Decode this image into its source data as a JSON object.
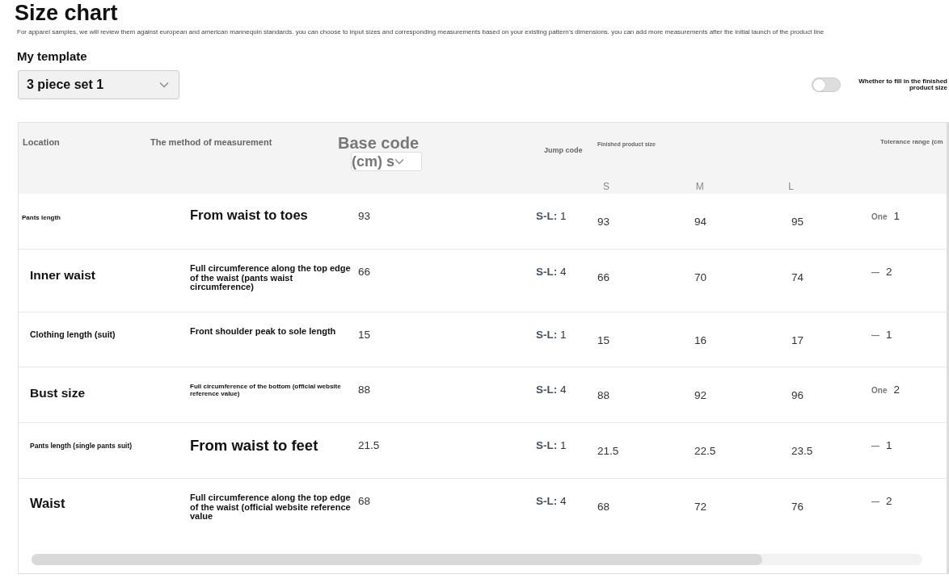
{
  "title": "Size chart",
  "description": "For apparel samples, we will review them against european and american mannequin standards. you can choose to input sizes and corresponding measurements based on your existing pattern's dimensions. you can add more measurements after the initial launch of the product line",
  "template": {
    "label": "My template",
    "value": "3 piece set 1"
  },
  "finished_toggle": {
    "label": "Whether to fill in the finished product size",
    "on": false
  },
  "table": {
    "columns": {
      "location": "Location",
      "method": "The method of measurement",
      "base_code": "Base code",
      "base_unit": "(cm) s",
      "jump": "Jump code",
      "finished": "Finished product size",
      "sizes": [
        "S",
        "M",
        "L"
      ],
      "tolerance": "Tolerance range (cm"
    },
    "rows": [
      {
        "location": "Pants length",
        "method": "From waist to toes",
        "base": "93",
        "jump": "**S-L:** 1",
        "sizes": [
          "93",
          "94",
          "95"
        ],
        "tol_prefix": "One",
        "tolerance": "1"
      },
      {
        "location": "Inner waist",
        "method": "Full circumference along the top edge of the waist (pants waist circumference)",
        "base": "66",
        "jump": "**S-L:** 4",
        "sizes": [
          "66",
          "70",
          "74"
        ],
        "tol_prefix": "—",
        "tolerance": "2"
      },
      {
        "location": "Clothing length (suit)",
        "method": "Front shoulder peak to sole length",
        "base": "15",
        "jump": "**S-L:** 1",
        "sizes": [
          "15",
          "16",
          "17"
        ],
        "tol_prefix": "—",
        "tolerance": "1"
      },
      {
        "location": "Bust size",
        "method": "Full circumference of the bottom (official website reference value)",
        "base": "88",
        "jump": "**S-L:** 4",
        "sizes": [
          "88",
          "92",
          "96"
        ],
        "tol_prefix": "One",
        "tolerance": "2"
      },
      {
        "location": "Pants length (single pants suit)",
        "method": "From waist to feet",
        "base": "21.5",
        "jump": "**S-L:** 1",
        "sizes": [
          "21.5",
          "22.5",
          "23.5"
        ],
        "tol_prefix": "—",
        "tolerance": "1"
      },
      {
        "location": "Waist",
        "method": "Full circumference along the top edge of the waist (official website reference value",
        "base": "68",
        "jump": "**S-L:** 4",
        "sizes": [
          "68",
          "72",
          "76"
        ],
        "tol_prefix": "—",
        "tolerance": "2"
      }
    ]
  }
}
